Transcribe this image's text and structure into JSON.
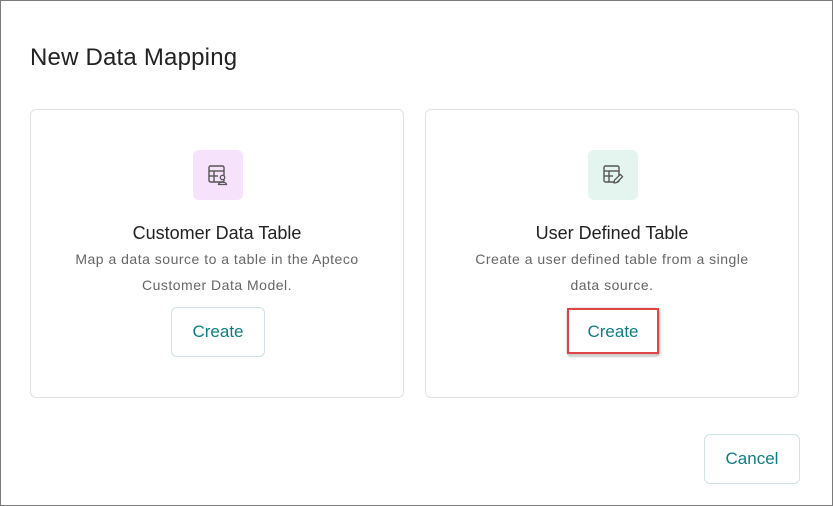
{
  "dialog": {
    "title": "New Data Mapping",
    "cancel_label": "Cancel"
  },
  "cards": [
    {
      "title": "Customer Data Table",
      "description": "Map a data source to a table in the Apteco Customer Data Model.",
      "button_label": "Create",
      "icon": "table-user-icon",
      "icon_bg": "#f6e3fb"
    },
    {
      "title": "User Defined Table",
      "description": "Create a user defined table from a single data source.",
      "button_label": "Create",
      "icon": "table-edit-icon",
      "icon_bg": "#e3f5ee"
    }
  ],
  "colors": {
    "accent": "#0e7c86",
    "highlight": "#e04545"
  }
}
